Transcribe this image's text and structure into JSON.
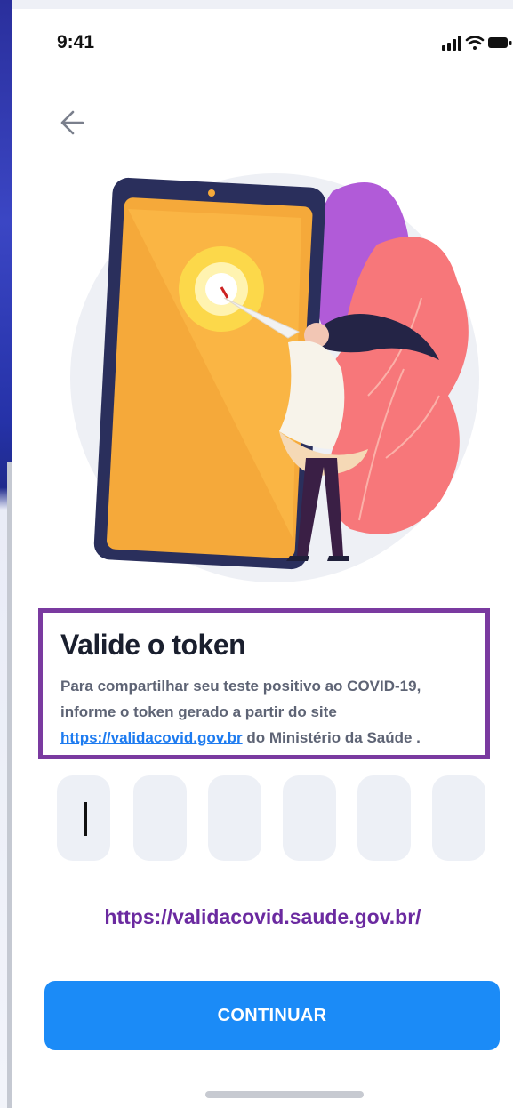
{
  "status_bar": {
    "time": "9:41",
    "icons": [
      "signal-icon",
      "wifi-icon",
      "battery-icon"
    ]
  },
  "nav": {
    "back_icon": "arrow-left-icon"
  },
  "card": {
    "title": "Valide o token",
    "description_part1": "Para compartilhar seu teste positivo ao COVID-19, informe o token gerado a partir do site ",
    "link_text": "https://validacovid.gov.br",
    "description_part2": " do Ministério da Saúde ."
  },
  "token": {
    "boxes": 6,
    "values": [
      "",
      "",
      "",
      "",
      "",
      ""
    ]
  },
  "site_link": "https://validacovid.saude.gov.br/",
  "continue_label": "CONTINUAR",
  "colors": {
    "primary": "#1b8bf7",
    "highlight_border": "#7a3aa0",
    "site_link": "#6b2aa0",
    "token_bg": "#edf0f6"
  }
}
